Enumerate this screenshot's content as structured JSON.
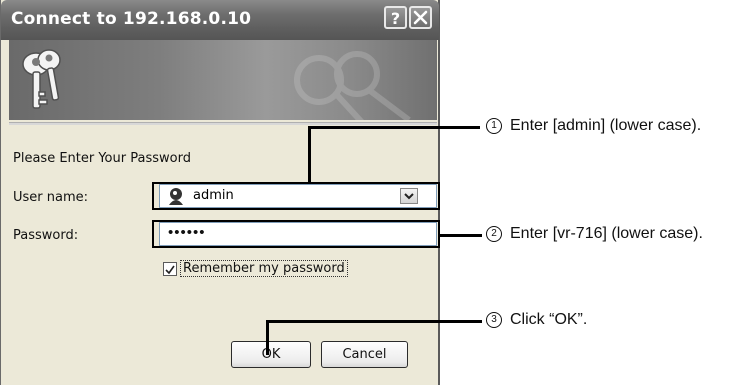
{
  "dialog": {
    "title": "Connect to 192.168.0.10",
    "help_label": "?",
    "close_label": "×",
    "prompt": "Please Enter Your Password",
    "username_label": "User name:",
    "username_value": "admin",
    "password_label": "Password:",
    "password_value": "••••••",
    "remember_label": "Remember my password",
    "remember_checked": true,
    "ok_label": "OK",
    "cancel_label": "Cancel"
  },
  "annotations": {
    "step1_number": "1",
    "step1_text": "Enter [admin] (lower case).",
    "step2_number": "2",
    "step2_text": "Enter [vr-716] (lower case).",
    "step3_number": "3",
    "step3_text": "Click “OK”."
  },
  "icons": [
    "keys-icon",
    "user-icon",
    "dropdown-arrow-icon",
    "checkbox-checked-icon",
    "help-icon",
    "close-icon"
  ]
}
